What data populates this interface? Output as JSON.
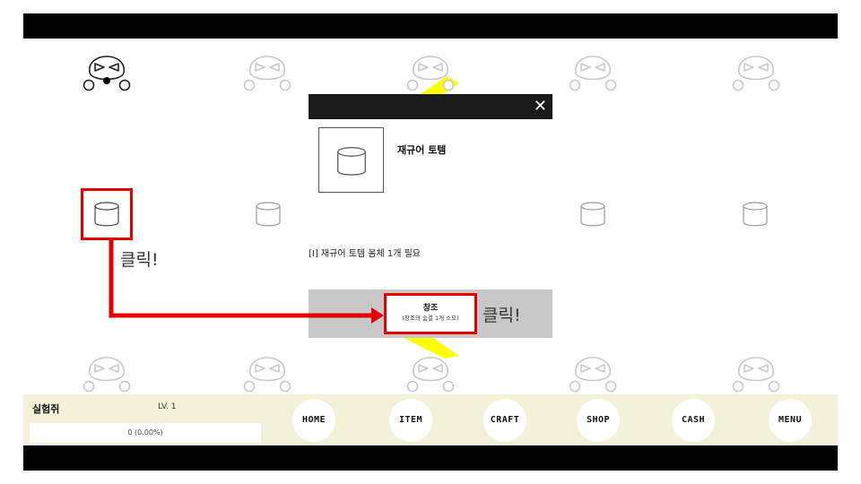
{
  "modal": {
    "close_symbol": "✕",
    "item_name": "재규어 토템",
    "requirement": "[I] 재규어 토템 몸체 1개 필요",
    "craft_label": "창조",
    "craft_cost": "(창조의 숨결 1개 소모)"
  },
  "hints": {
    "click_1": "클릭!",
    "click_2": "클릭!"
  },
  "player": {
    "name": "실험쥐",
    "level": "LV. 1",
    "exp": "0 (0.00%)",
    "exp_fraction": 0
  },
  "nav": {
    "home": "HOME",
    "item": "ITEM",
    "craft": "CRAFT",
    "shop": "SHOP",
    "cash": "CASH",
    "menu": "MENU"
  },
  "icons": {
    "mascot": "angry-mascot-icon",
    "totem": "totem-body-icon",
    "close": "close-icon"
  },
  "colors": {
    "highlight": "#e50000",
    "beam": "#ffff00",
    "panel": "#f4f1d9",
    "modal_header": "#1a1a1a"
  }
}
